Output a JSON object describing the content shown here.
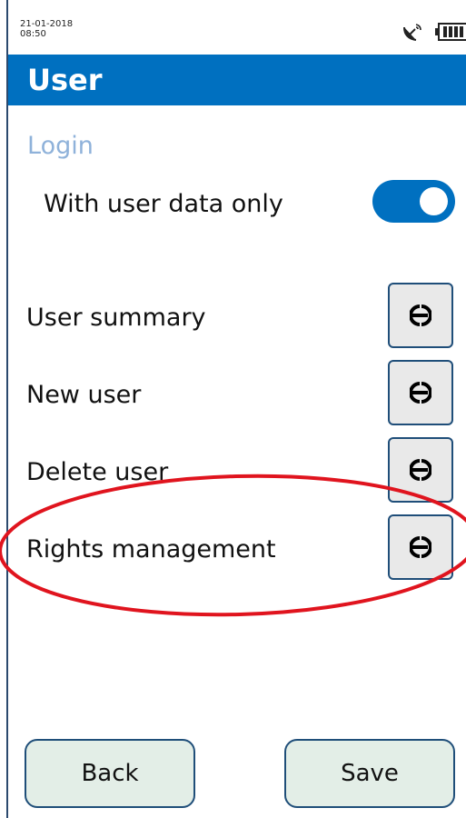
{
  "status_bar": {
    "date": "21-01-2018",
    "time": "08:50",
    "signal_icon": "satellite-dish-icon",
    "battery_icon": "battery-full-icon"
  },
  "header": {
    "title": "User",
    "color": "#0070c0"
  },
  "login": {
    "section_title": "Login",
    "with_user_data_only": {
      "label": "With user data only",
      "enabled": true
    }
  },
  "menu": {
    "items": [
      {
        "label": "User summary",
        "icon": "arrow-right-icon"
      },
      {
        "label": "New user",
        "icon": "arrow-right-icon"
      },
      {
        "label": "Delete user",
        "icon": "arrow-right-icon"
      },
      {
        "label": "Rights management",
        "icon": "arrow-right-icon"
      }
    ]
  },
  "footer": {
    "back_label": "Back",
    "save_label": "Save"
  },
  "annotation": {
    "shape": "ellipse",
    "color": "#e0141e",
    "highlights": "Rights management"
  }
}
